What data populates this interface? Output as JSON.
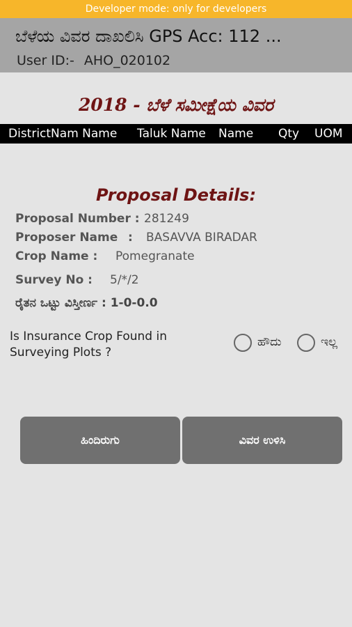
{
  "dev_banner": "Developer mode: only for developers",
  "header": {
    "title": "ಬೆಳೆಯ ವಿವರ ದಾಖಲಿಸಿ GPS Acc: 112 ...",
    "user_label": "User ID:-",
    "user_id": "AHO_020102"
  },
  "survey_title": "2018 - ಬೆಳೆ ಸಮೀಕ್ಷೆಯ ವಿವರ",
  "table_columns": [
    "DistrictNam Name",
    "Taluk Name",
    "Name",
    "Qty",
    "UOM"
  ],
  "proposal": {
    "heading": "Proposal Details:",
    "number_label": "Proposal Number :",
    "number_value": "281249",
    "proposer_label": "Proposer Name",
    "proposer_colon": ":",
    "proposer_value": "BASAVVA BIRADAR",
    "crop_label": "Crop Name :",
    "crop_value": "Pomegranate",
    "survey_label": "Survey No :",
    "survey_value": "5/*/2",
    "area_label": "ರೈತನ ಒಟ್ಟು ವಿಸ್ತೀರ್ಣ : 1-0-0.0"
  },
  "question": {
    "text_line1": "Is Insurance Crop Found in",
    "text_line2": "Surveying Plots ?",
    "option_yes": "ಹೌದು",
    "option_no": "ಇಲ್ಲ",
    "selected": "none"
  },
  "buttons": {
    "back": "ಹಿಂದಿರುಗು",
    "save": "ವಿವರ ಉಳಿಸಿ"
  },
  "colors": {
    "banner": "#f7b62a",
    "header": "#a5a5a5",
    "accent_title": "#6e1414",
    "button": "#707070",
    "background": "#e4e4e4"
  }
}
